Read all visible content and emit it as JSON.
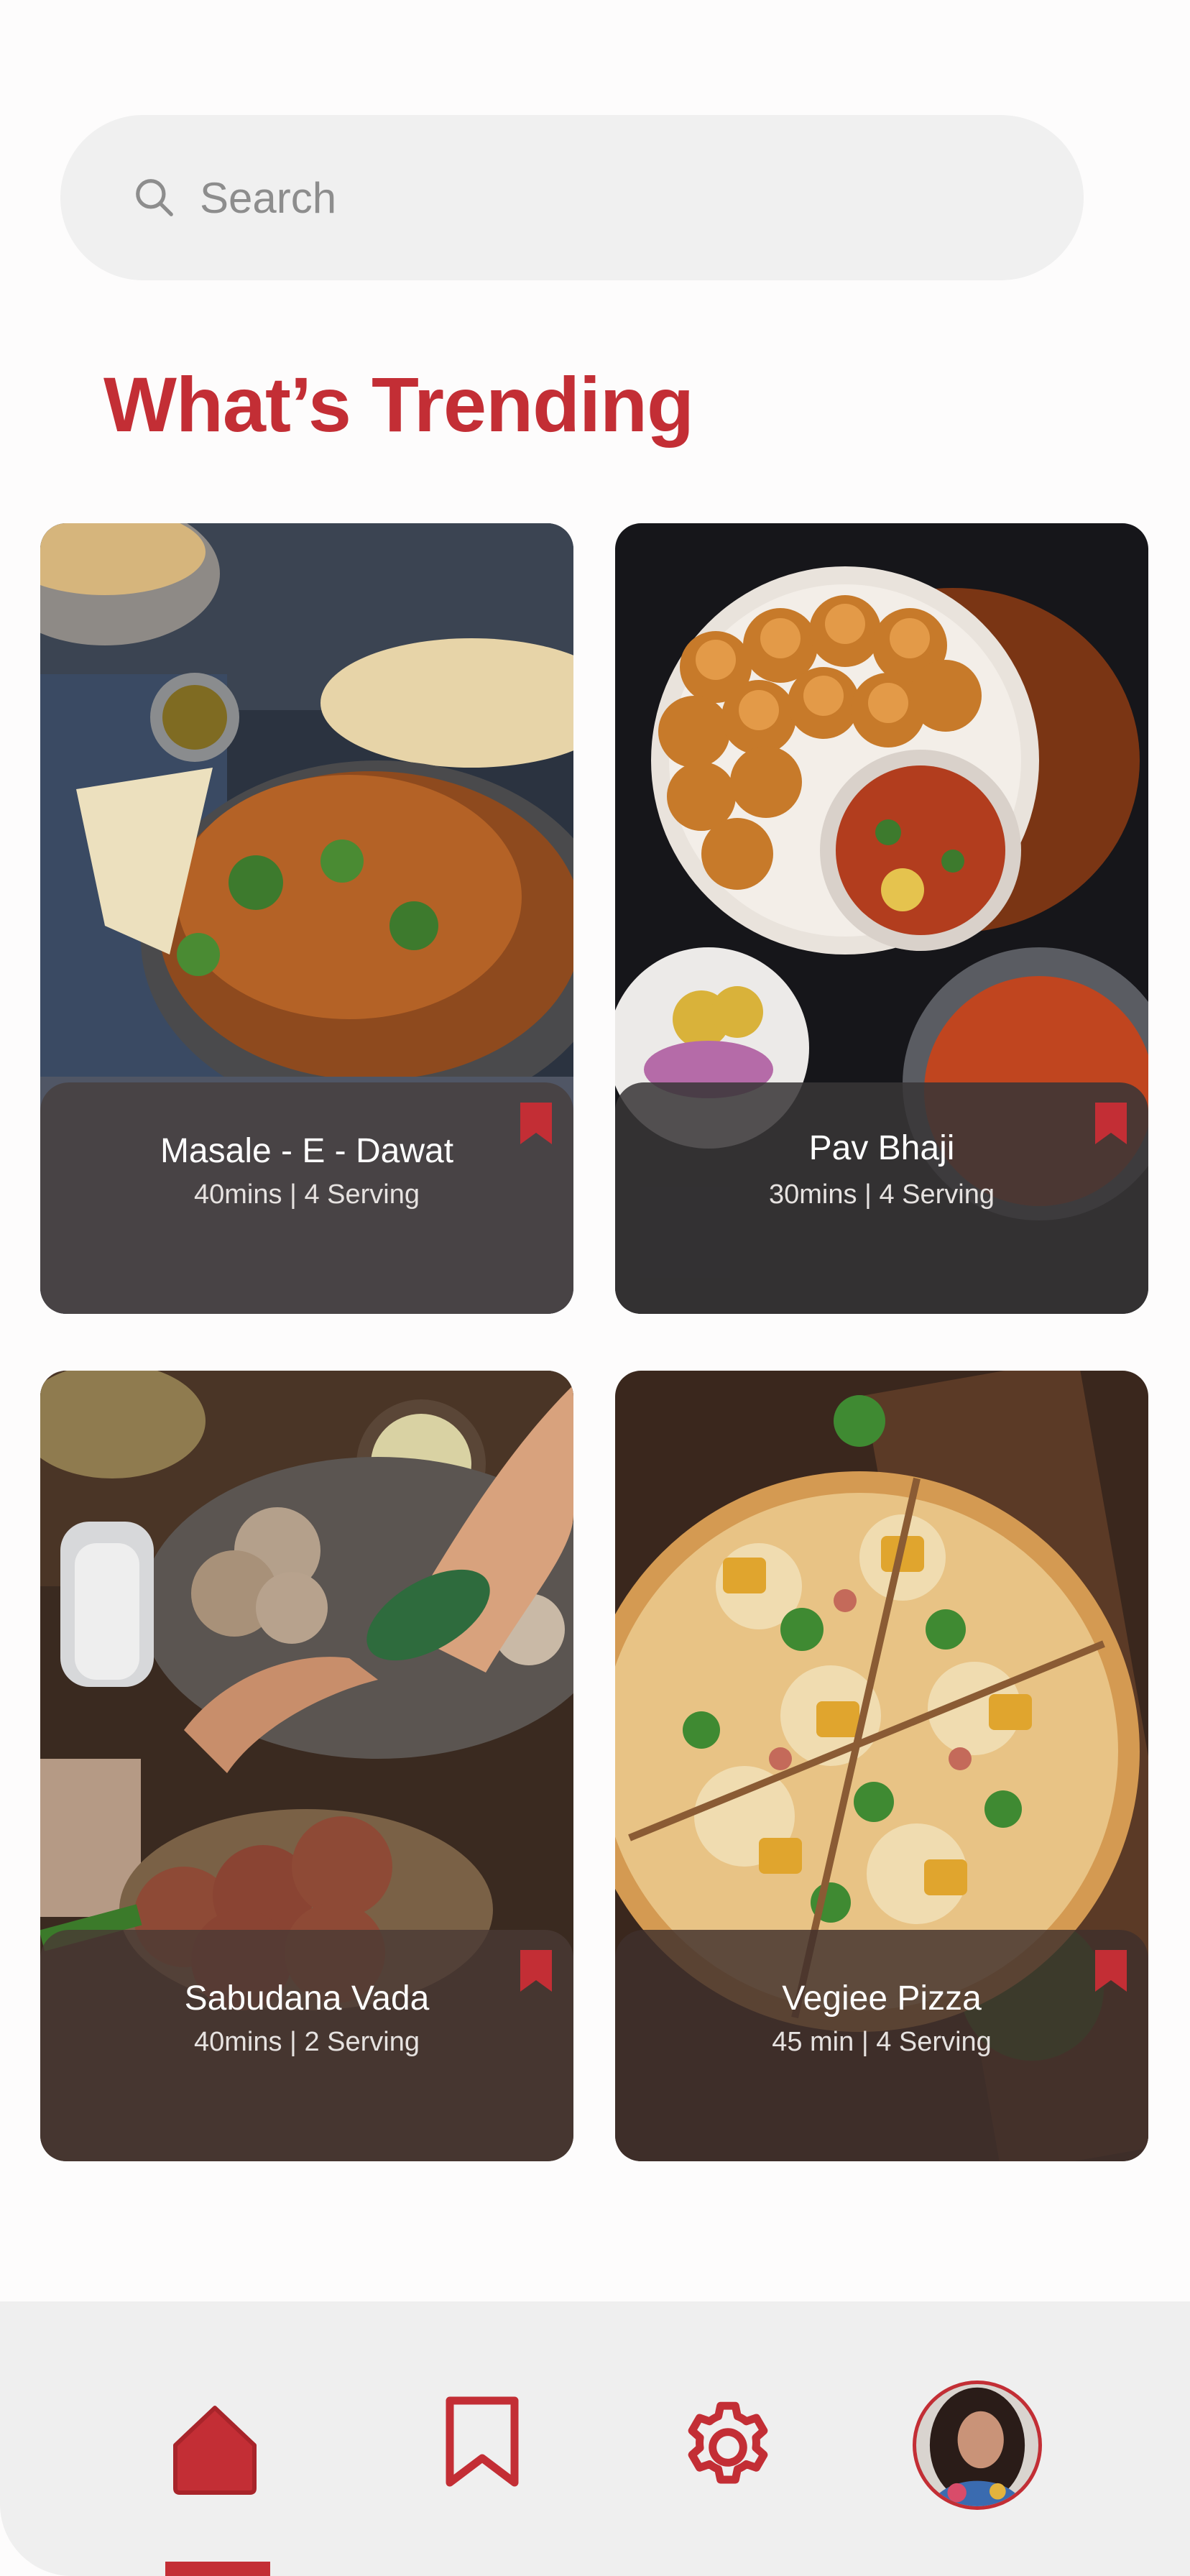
{
  "search": {
    "placeholder": "Search",
    "icon": "search-icon"
  },
  "section_title": "What’s Trending",
  "colors": {
    "accent": "#c32e35",
    "nav_background": "#efefef",
    "search_background": "#f0f0f0"
  },
  "recipes": [
    {
      "name": "Masale - E - Dawat",
      "meta": "40mins | 4 Serving",
      "image": "curry-with-naan-photo"
    },
    {
      "name": "Pav Bhaji",
      "meta": "30mins | 4 Serving",
      "image": "pav-bhaji-photo"
    },
    {
      "name": "Sabudana Vada",
      "meta": "40mins | 2 Serving",
      "image": "sabudana-vada-photo"
    },
    {
      "name": "Vegiee Pizza",
      "meta": "45 min | 4 Serving",
      "image": "veggie-pizza-photo"
    }
  ],
  "nav": {
    "items": [
      "home-icon",
      "bookmark-icon",
      "gear-icon",
      "profile-avatar"
    ],
    "active": "home"
  }
}
